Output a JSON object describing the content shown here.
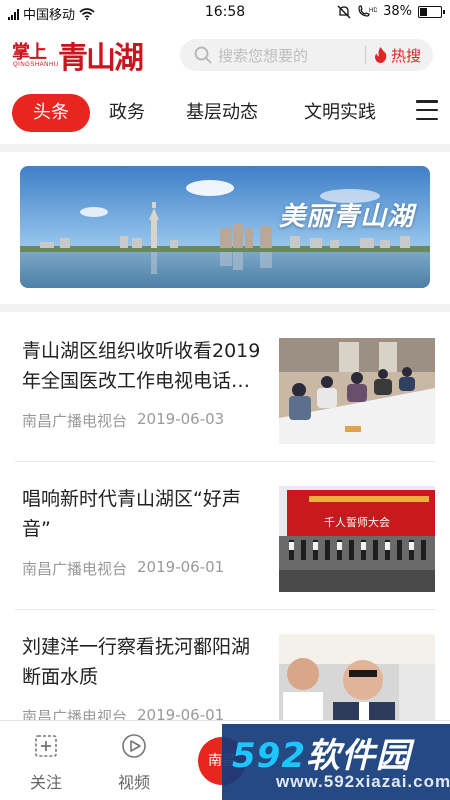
{
  "status_bar": {
    "carrier": "中国移动",
    "time": "16:58",
    "battery": "38%",
    "battery_level": 0.38
  },
  "header": {
    "logo_small": "掌上",
    "logo_pinyin": "QINGSHANHU",
    "logo_big": "青山湖",
    "search_placeholder": "搜索您想要的",
    "hot_label": "热搜"
  },
  "tabs": [
    {
      "label": "头条",
      "active": true
    },
    {
      "label": "政务"
    },
    {
      "label": "基层动态"
    },
    {
      "label": "文明实践"
    }
  ],
  "banner": {
    "title": "美丽青山湖"
  },
  "news": [
    {
      "title": "青山湖区组织收听收看2019年全国医改工作电视电话…",
      "source": "南昌广播电视台",
      "date": "2019-06-03"
    },
    {
      "title": "唱响新时代青山湖区“好声音”",
      "source": "南昌广播电视台",
      "date": "2019-06-01",
      "image_caption": "千人誓师大会"
    },
    {
      "title": "刘建洋一行察看抚河鄱阳湖断面水质",
      "source": "南昌广播电视台",
      "date": "2019-06-01"
    }
  ],
  "bottom_nav": {
    "items": [
      {
        "label": "关注",
        "icon": "plus-square-icon"
      },
      {
        "label": "视频",
        "icon": "play-circle-icon"
      }
    ],
    "center_label": "南昌"
  },
  "watermark": {
    "number": "592",
    "text": "软件园",
    "url": "www.592xiazai.com"
  },
  "colors": {
    "brand_red": "#e8251e",
    "logo_red": "#c9151e",
    "meta_gray": "#9a9a9a"
  }
}
